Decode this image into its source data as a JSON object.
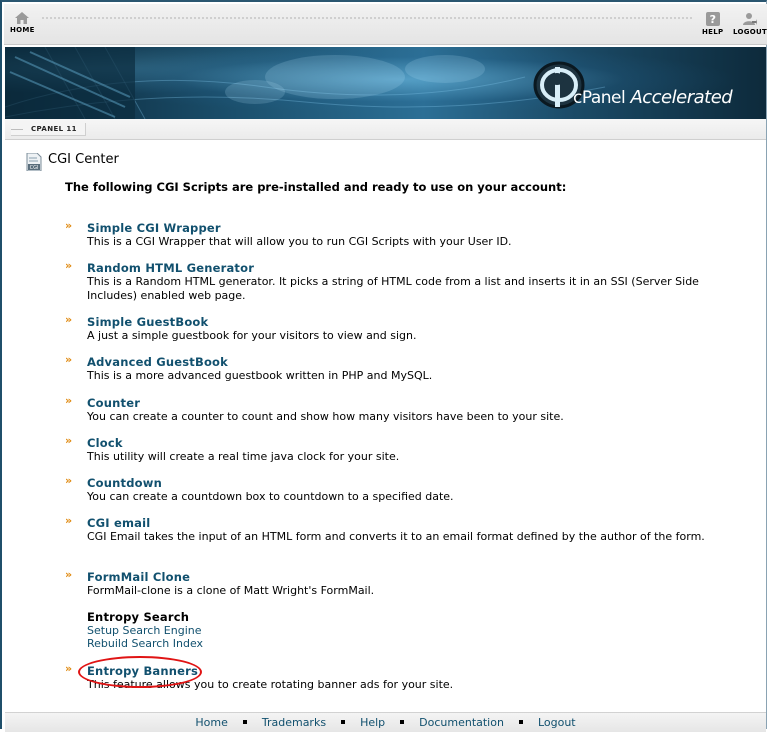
{
  "nav": {
    "home_label": "HOME",
    "help_label": "HELP",
    "logout_label": "LOGOUT"
  },
  "banner": {
    "logo_text": "cPanel Accelerated",
    "logo_c": "cPanel",
    "logo_accel": "Accelerated"
  },
  "version": {
    "label": "CPANEL 11"
  },
  "page": {
    "title": "CGI Center",
    "intro": "The following CGI Scripts are pre-installed and ready to use on your account:"
  },
  "scripts": [
    {
      "title": "Simple CGI Wrapper",
      "desc": "This is a CGI Wrapper that will allow you to run CGI Scripts with your User ID."
    },
    {
      "title": "Random HTML Generator",
      "desc": "This is a Random HTML generator. It picks a string of HTML code from a list and inserts it in an SSI (Server Side Includes) enabled web page."
    },
    {
      "title": "Simple GuestBook",
      "desc": "A just a simple guestbook for your visitors to view and sign."
    },
    {
      "title": "Advanced GuestBook",
      "desc": "This is a more advanced guestbook written in PHP and MySQL."
    },
    {
      "title": "Counter",
      "desc": "You can create a counter to count and show how many visitors have been to your site."
    },
    {
      "title": "Clock",
      "desc": "This utility will create a real time java clock for your site."
    },
    {
      "title": "Countdown",
      "desc": "You can create a countdown box to countdown to a specified date."
    },
    {
      "title": "CGI email",
      "desc": "CGI Email takes the input of an HTML form and converts it to an email format defined by the author of the form."
    },
    {
      "title": "FormMail Clone",
      "desc": "FormMail-clone is a clone of Matt Wright's FormMail."
    },
    {
      "title": "Entropy Search",
      "links": [
        "Setup Search Engine",
        "Rebuild Search Index"
      ]
    },
    {
      "title": "Entropy Banners",
      "desc": "This feature allows you to create rotating banner ads for your site."
    }
  ],
  "footer": {
    "links": [
      "Home",
      "Trademarks",
      "Help",
      "Documentation",
      "Logout"
    ]
  },
  "colors": {
    "link": "#11506e",
    "bullet": "#e08a10",
    "highlight": "#e01414",
    "banner_dark": "#0a2434",
    "banner_light": "#2c6f95"
  },
  "icons": {
    "home": "house-icon",
    "help": "question-icon",
    "logout": "user-logout-icon",
    "title": "cgi-document-icon",
    "bullet": "double-chevron-icon"
  }
}
